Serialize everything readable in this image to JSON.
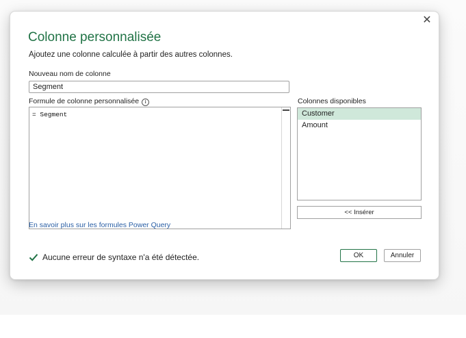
{
  "dialog": {
    "title": "Colonne personnalisée",
    "subtitle": "Ajoutez une colonne calculée à partir des autres colonnes.",
    "close_icon": "close-icon"
  },
  "new_column": {
    "label": "Nouveau nom de colonne",
    "value": "Segment"
  },
  "formula": {
    "label": "Formule de colonne personnalisée",
    "info_icon": "info-icon",
    "info_glyph": "i",
    "value": "= Segment"
  },
  "available_columns": {
    "label": "Colonnes disponibles",
    "items": [
      "Customer",
      "Amount"
    ],
    "selected": "Customer",
    "insert_label": "<< Insérer"
  },
  "learn_more_link": "En savoir plus sur les formules Power Query",
  "status": {
    "icon": "checkmark-icon",
    "text": "Aucune erreur de syntaxe n'a été détectée.",
    "color": "#217346"
  },
  "buttons": {
    "ok": "OK",
    "cancel": "Annuler"
  },
  "colors": {
    "accent": "#217346",
    "selected_row": "#cfe8da",
    "link": "#2a5fa5"
  }
}
